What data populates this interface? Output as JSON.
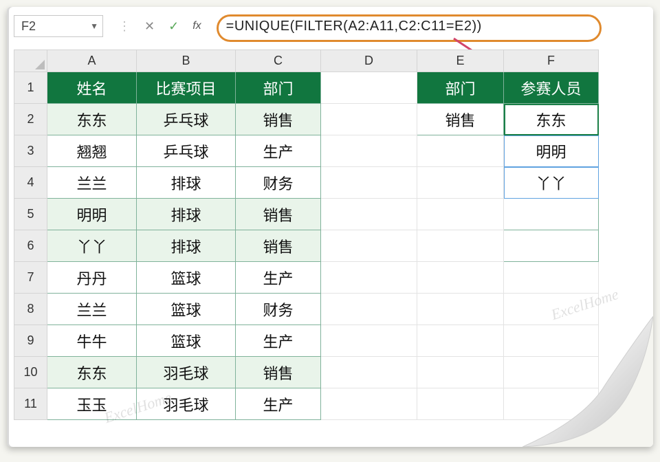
{
  "namebox": {
    "value": "F2"
  },
  "formula_bar": {
    "cancel_glyph": "✕",
    "confirm_glyph": "✓",
    "fx_label": "fx",
    "formula": "=UNIQUE(FILTER(A2:A11,C2:C11=E2))"
  },
  "columns": [
    "A",
    "B",
    "C",
    "D",
    "E",
    "F"
  ],
  "row_numbers": [
    "1",
    "2",
    "3",
    "4",
    "5",
    "6",
    "7",
    "8",
    "9",
    "10",
    "11"
  ],
  "headers_left": {
    "A1": "姓名",
    "B1": "比赛项目",
    "C1": "部门"
  },
  "headers_right": {
    "E1": "部门",
    "F1": "参赛人员"
  },
  "left_table": [
    {
      "name": "东东",
      "event": "乒乓球",
      "dept": "销售",
      "tint": true
    },
    {
      "name": "翘翘",
      "event": "乒乓球",
      "dept": "生产",
      "tint": false
    },
    {
      "name": "兰兰",
      "event": "排球",
      "dept": "财务",
      "tint": false
    },
    {
      "name": "明明",
      "event": "排球",
      "dept": "销售",
      "tint": true
    },
    {
      "name": "丫丫",
      "event": "排球",
      "dept": "销售",
      "tint": true
    },
    {
      "name": "丹丹",
      "event": "篮球",
      "dept": "生产",
      "tint": false
    },
    {
      "name": "兰兰",
      "event": "篮球",
      "dept": "财务",
      "tint": false
    },
    {
      "name": "牛牛",
      "event": "篮球",
      "dept": "生产",
      "tint": false
    },
    {
      "name": "东东",
      "event": "羽毛球",
      "dept": "销售",
      "tint": true
    },
    {
      "name": "玉玉",
      "event": "羽毛球",
      "dept": "生产",
      "tint": false
    }
  ],
  "right_side": {
    "E2": "销售",
    "F_results": [
      "东东",
      "明明",
      "丫丫"
    ]
  },
  "watermark": "ExcelHome"
}
